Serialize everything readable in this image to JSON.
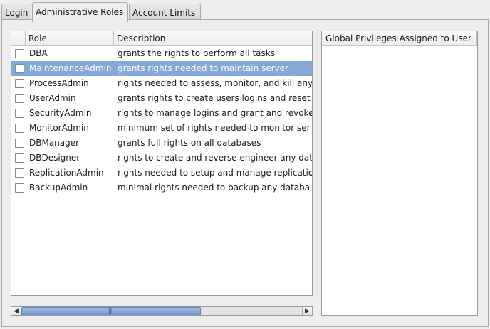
{
  "tabs": [
    {
      "label": "Login"
    },
    {
      "label": "Administrative Roles"
    },
    {
      "label": "Account Limits"
    }
  ],
  "roles_table": {
    "columns": {
      "role": "Role",
      "description": "Description"
    },
    "rows": [
      {
        "role": "DBA",
        "description": "grants the rights to perform all tasks",
        "checked": false,
        "selected": false
      },
      {
        "role": "MaintenanceAdmin",
        "description": "grants rights needed to maintain server",
        "checked": false,
        "selected": true
      },
      {
        "role": "ProcessAdmin",
        "description": "rights needed to assess, monitor, and kill any",
        "checked": false,
        "selected": false
      },
      {
        "role": "UserAdmin",
        "description": "grants rights to create users logins and reset",
        "checked": false,
        "selected": false
      },
      {
        "role": "SecurityAdmin",
        "description": "rights to manage logins and grant and revoke",
        "checked": false,
        "selected": false
      },
      {
        "role": "MonitorAdmin",
        "description": "minimum set of rights needed to monitor ser",
        "checked": false,
        "selected": false
      },
      {
        "role": "DBManager",
        "description": "grants full rights on all databases",
        "checked": false,
        "selected": false
      },
      {
        "role": "DBDesigner",
        "description": "rights to create and reverse engineer any dat",
        "checked": false,
        "selected": false
      },
      {
        "role": "ReplicationAdmin",
        "description": "rights needed to setup and manage replicatio",
        "checked": false,
        "selected": false
      },
      {
        "role": "BackupAdmin",
        "description": "minimal rights needed to backup any databa",
        "checked": false,
        "selected": false
      }
    ]
  },
  "scrollbar": {
    "left_icon": "chevron-left-icon",
    "right_icon": "chevron-right-icon",
    "grip": "|||"
  },
  "privileges_panel": {
    "header": "Global Privileges Assigned to User"
  },
  "colors": {
    "selection": "#86a8d6",
    "accent": "#6f98cf"
  }
}
